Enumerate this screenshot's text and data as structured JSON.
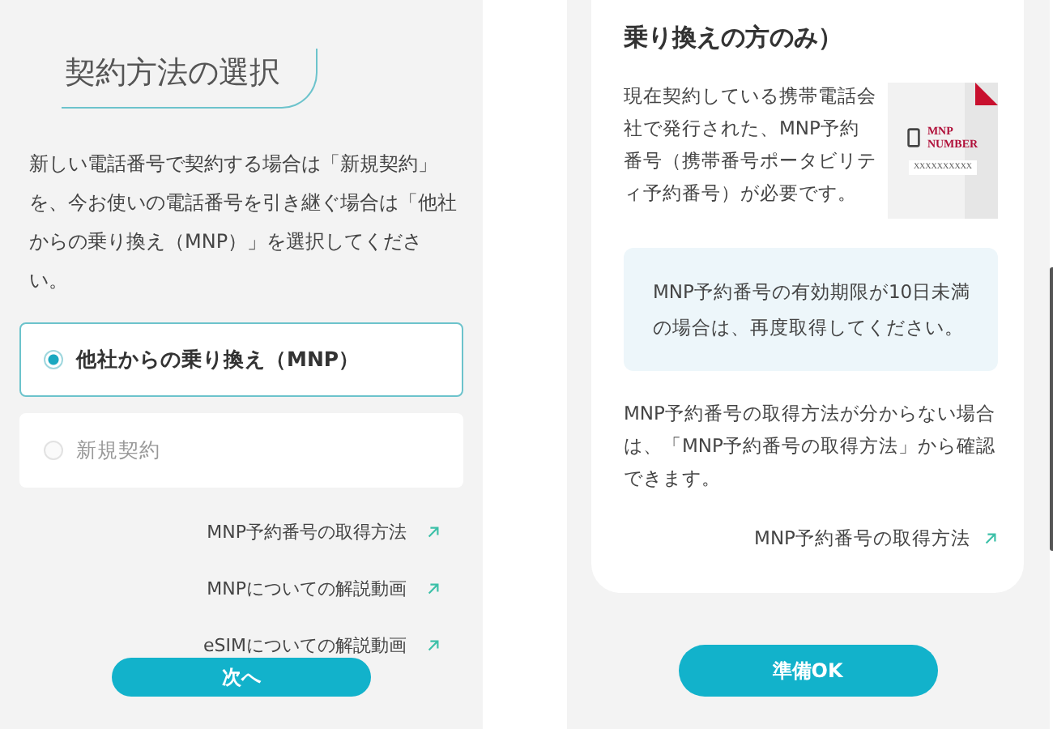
{
  "left_screen": {
    "title": "契約方法の選択",
    "description": "新しい電話番号で契約する場合は「新規契約」を、今お使いの電話番号を引き継ぐ場合は「他社からの乗り換え（MNP）」を選択してください。",
    "options": [
      {
        "label": "他社からの乗り換え（MNP）",
        "selected": true
      },
      {
        "label": "新規契約",
        "selected": false
      }
    ],
    "links": [
      "MNP予約番号の取得方法",
      "MNPについての解説動画",
      "eSIMについての解説動画"
    ],
    "button": "次へ"
  },
  "right_screen": {
    "heading": "乗り換えの方のみ）",
    "body": "現在契約している携帯電話会社で発行された、MNP予約番号（携帯番号ポータビリティ予約番号）が必要です。",
    "card_image": {
      "label_lines": [
        "MNP",
        "NUMBER"
      ],
      "number": "XXXXXXXXXX"
    },
    "notice": "MNP予約番号の有効期限が10日未満の場合は、再度取得してください。",
    "help_text": "MNP予約番号の取得方法が分からない場合は、「MNP予約番号の取得方法」から確認できます。",
    "link": "MNP予約番号の取得方法",
    "button": "準備OK"
  }
}
